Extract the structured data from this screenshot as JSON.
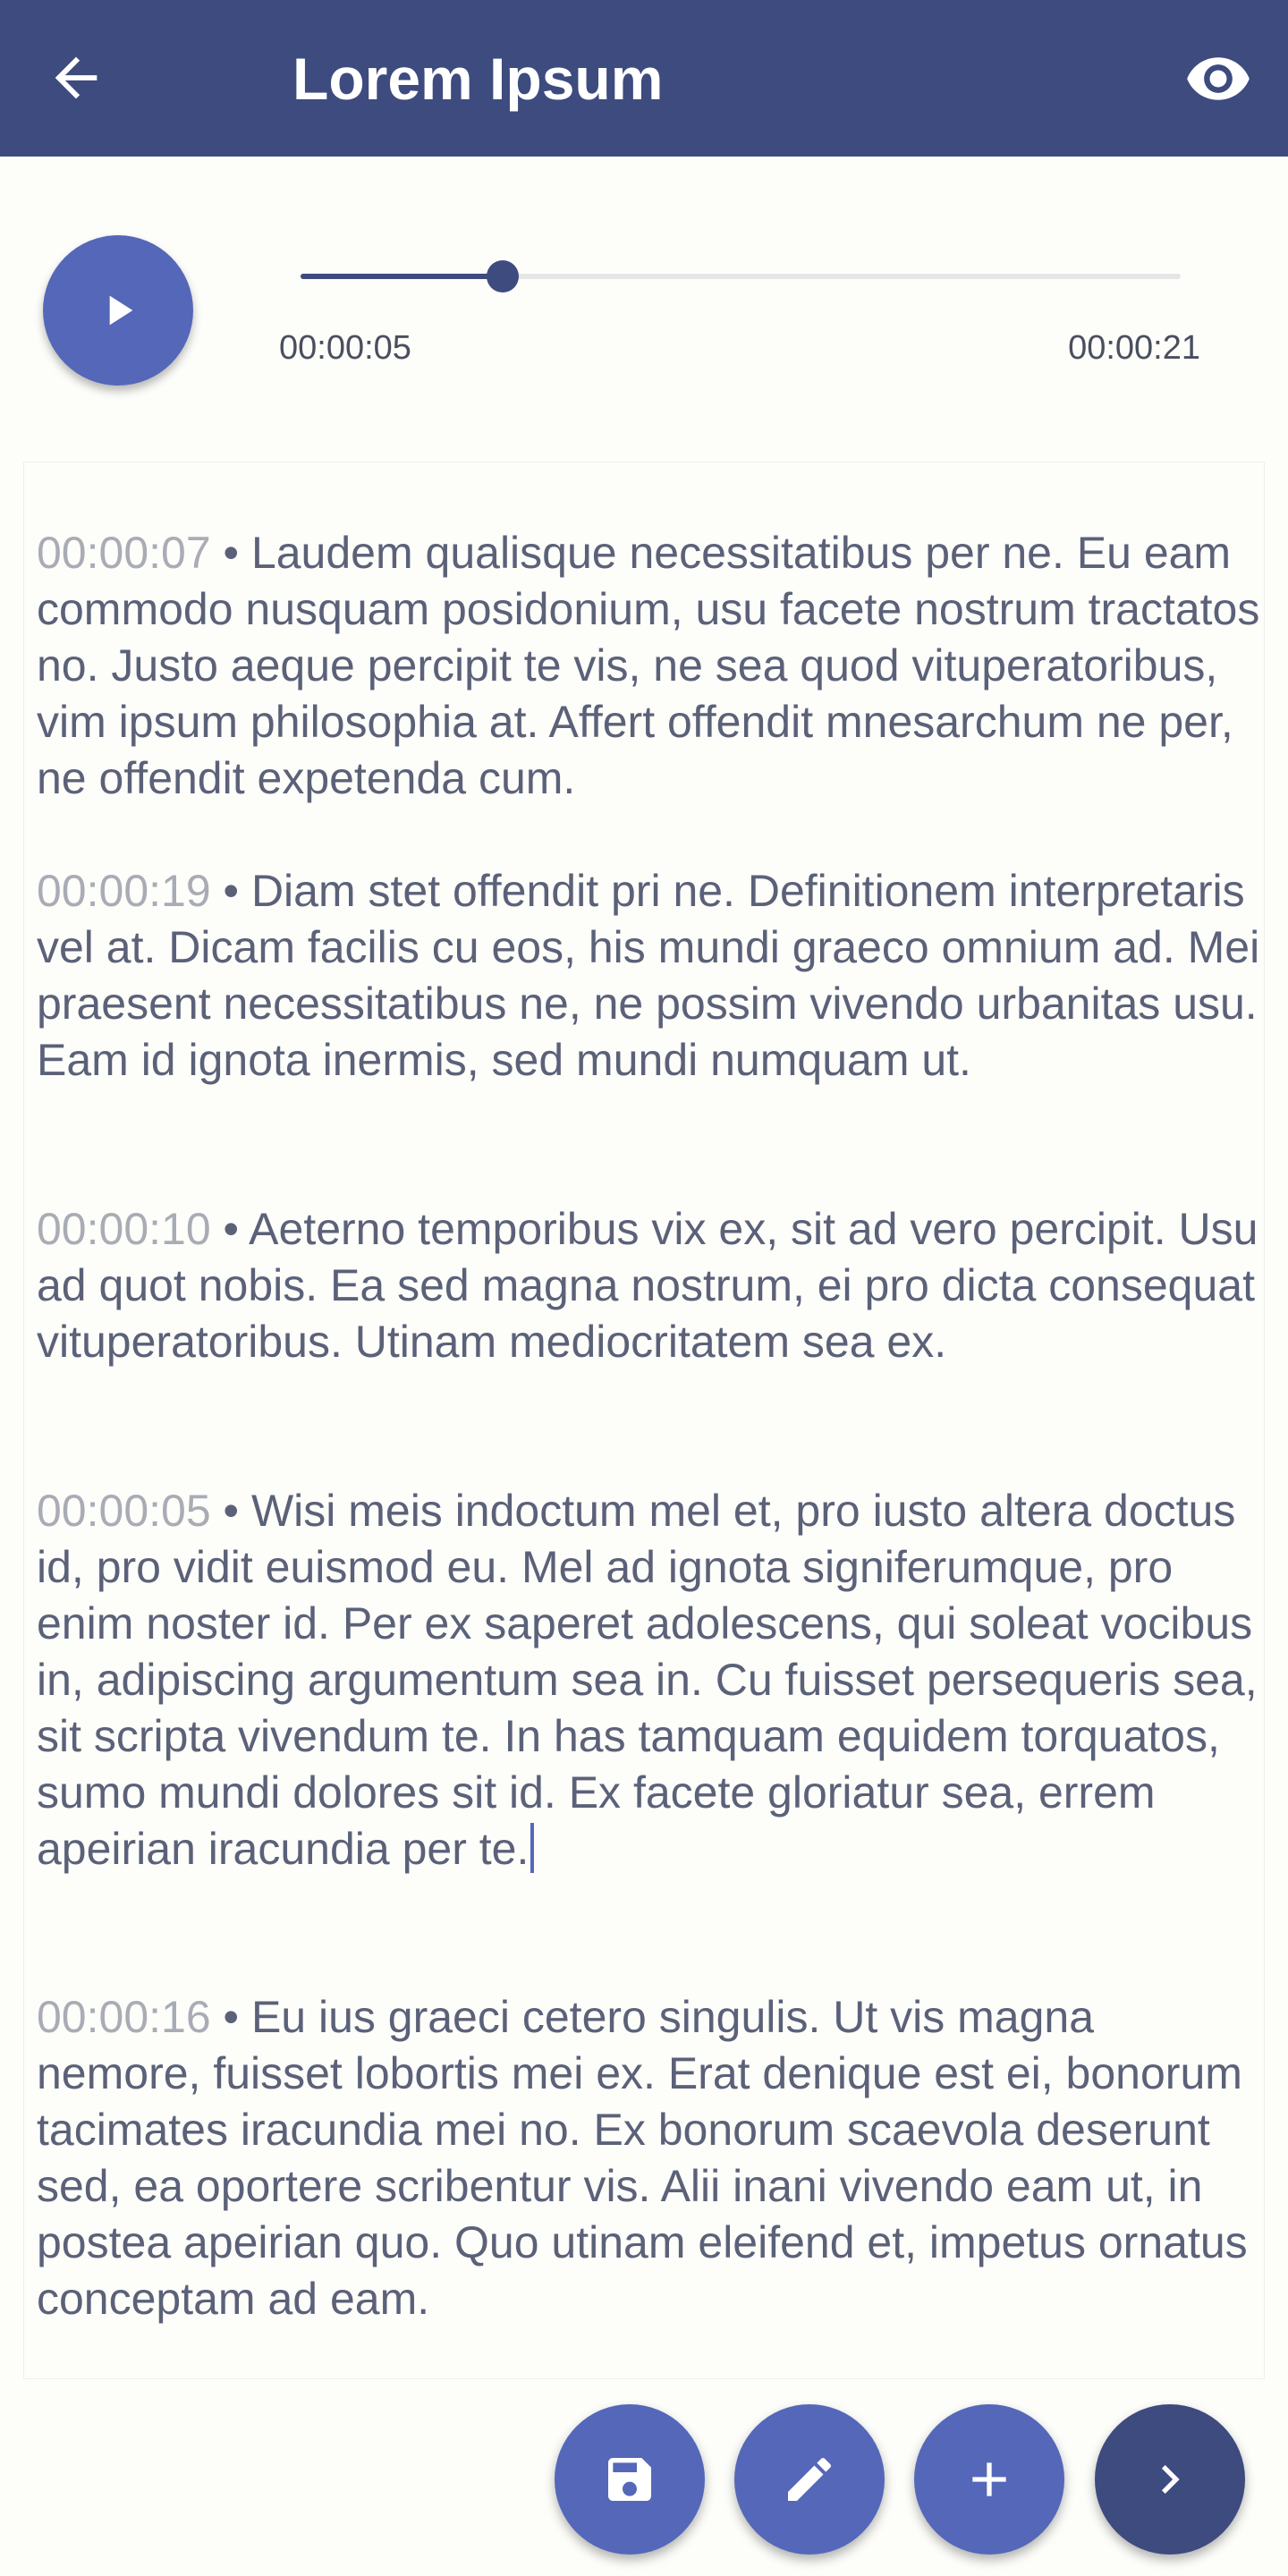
{
  "app_bar": {
    "title": "Lorem Ipsum",
    "color": "#3d4b7e"
  },
  "player": {
    "current_time": "00:00:05",
    "total_time": "00:00:21",
    "progress": 0.23,
    "accent": "#5567b9"
  },
  "transcript": {
    "entries": [
      {
        "timestamp": "00:00:07",
        "separator": " • ",
        "text": "Laudem qualisque necessitatibus per ne. Eu eam commodo nusquam posidonium, usu facete nostrum tractatos no. Justo aeque percipit te vis, ne sea quod vituperatoribus, vim ipsum philosophia at. Affert offendit mnesarchum ne per, ne offendit expetenda cum."
      },
      {
        "timestamp": "00:00:19",
        "separator": " • ",
        "text": "Diam stet offendit pri ne. Definitionem interpretaris vel at. Dicam facilis cu eos, his mundi graeco omnium ad. Mei praesent necessitatibus ne, ne possim vivendo urbanitas usu. Eam id ignota inermis, sed mundi numquam ut."
      },
      {
        "timestamp": "00:00:10",
        "separator": " • ",
        "text": "Aeterno temporibus vix ex, sit ad vero percipit. Usu ad quot nobis. Ea sed magna nostrum, ei pro dicta consequat vituperatoribus. Utinam mediocritatem sea ex."
      },
      {
        "timestamp": "00:00:05",
        "separator": " • ",
        "text": "Wisi meis indoctum mel et, pro iusto altera doctus id, pro vidit euismod eu. Mel ad ignota signiferumque, pro enim noster id. Per ex saperet adolescens, qui soleat vocibus in, adipiscing argumentum sea in. Cu fuisset persequeris sea, sit scripta vivendum te. In has tamquam equidem torquatos, sumo mundi dolores sit id. Ex facete gloriatur sea, errem apeirian iracundia per te."
      },
      {
        "timestamp": "00:00:16",
        "separator": " • ",
        "text": "Eu ius graeci cetero singulis. Ut vis magna nemore, fuisset lobortis mei ex. Erat denique est ei, bonorum tacimates iracundia mei no. Ex bonorum scaevola deserunt sed, ea oportere scribentur vis. Alii inani vivendo eam ut, in postea apeirian quo. Quo utinam eleifend et, impetus ornatus conceptam ad eam."
      }
    ]
  },
  "actions": {
    "icons": [
      "save-icon",
      "edit-icon",
      "add-icon",
      "chevron-right-icon"
    ]
  }
}
